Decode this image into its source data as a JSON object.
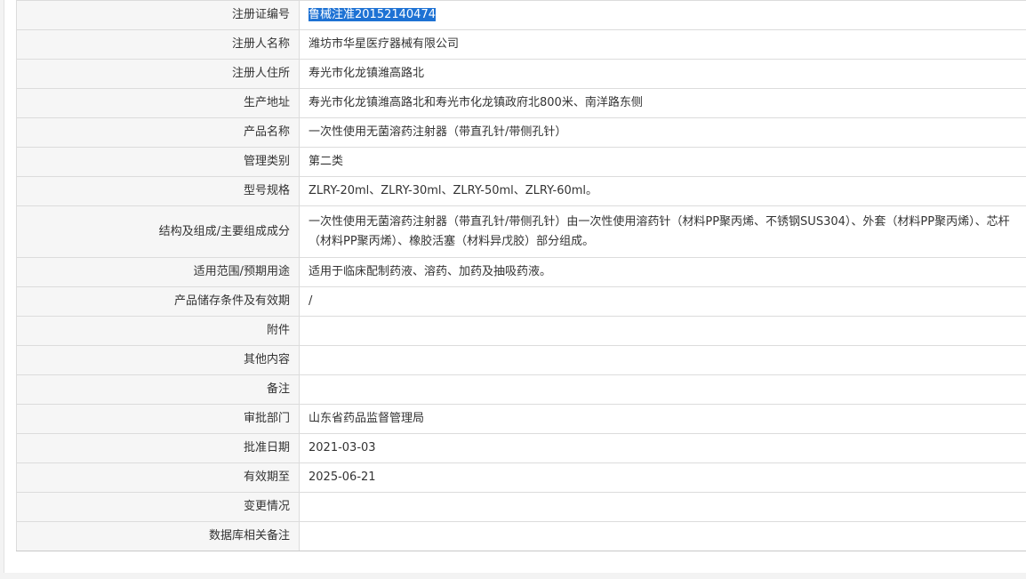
{
  "rows": [
    {
      "label": "注册证编号",
      "value": "鲁械注准20152140474",
      "selected": true
    },
    {
      "label": "注册人名称",
      "value": "潍坊市华星医疗器械有限公司"
    },
    {
      "label": "注册人住所",
      "value": "寿光市化龙镇潍高路北"
    },
    {
      "label": "生产地址",
      "value": "寿光市化龙镇潍高路北和寿光市化龙镇政府北800米、南洋路东侧"
    },
    {
      "label": "产品名称",
      "value": "一次性使用无菌溶药注射器（带直孔针/带侧孔针）"
    },
    {
      "label": "管理类别",
      "value": "第二类"
    },
    {
      "label": "型号规格",
      "value": "ZLRY-20ml、ZLRY-30ml、ZLRY-50ml、ZLRY-60ml。"
    },
    {
      "label": "结构及组成/主要组成成分",
      "value": "一次性使用无菌溶药注射器（带直孔针/带侧孔针）由一次性使用溶药针（材料PP聚丙烯、不锈钢SUS304）、外套（材料PP聚丙烯）、芯杆（材料PP聚丙烯）、橡胶活塞（材料异戊胶）部分组成。"
    },
    {
      "label": "适用范围/预期用途",
      "value": "适用于临床配制药液、溶药、加药及抽吸药液。"
    },
    {
      "label": "产品储存条件及有效期",
      "value": "/"
    },
    {
      "label": "附件",
      "value": ""
    },
    {
      "label": "其他内容",
      "value": ""
    },
    {
      "label": "备注",
      "value": ""
    },
    {
      "label": "审批部门",
      "value": "山东省药品监督管理局"
    },
    {
      "label": "批准日期",
      "value": "2021-03-03"
    },
    {
      "label": "有效期至",
      "value": "2025-06-21"
    },
    {
      "label": "变更情况",
      "value": ""
    },
    {
      "label": "数据库相关备注",
      "value": ""
    }
  ]
}
